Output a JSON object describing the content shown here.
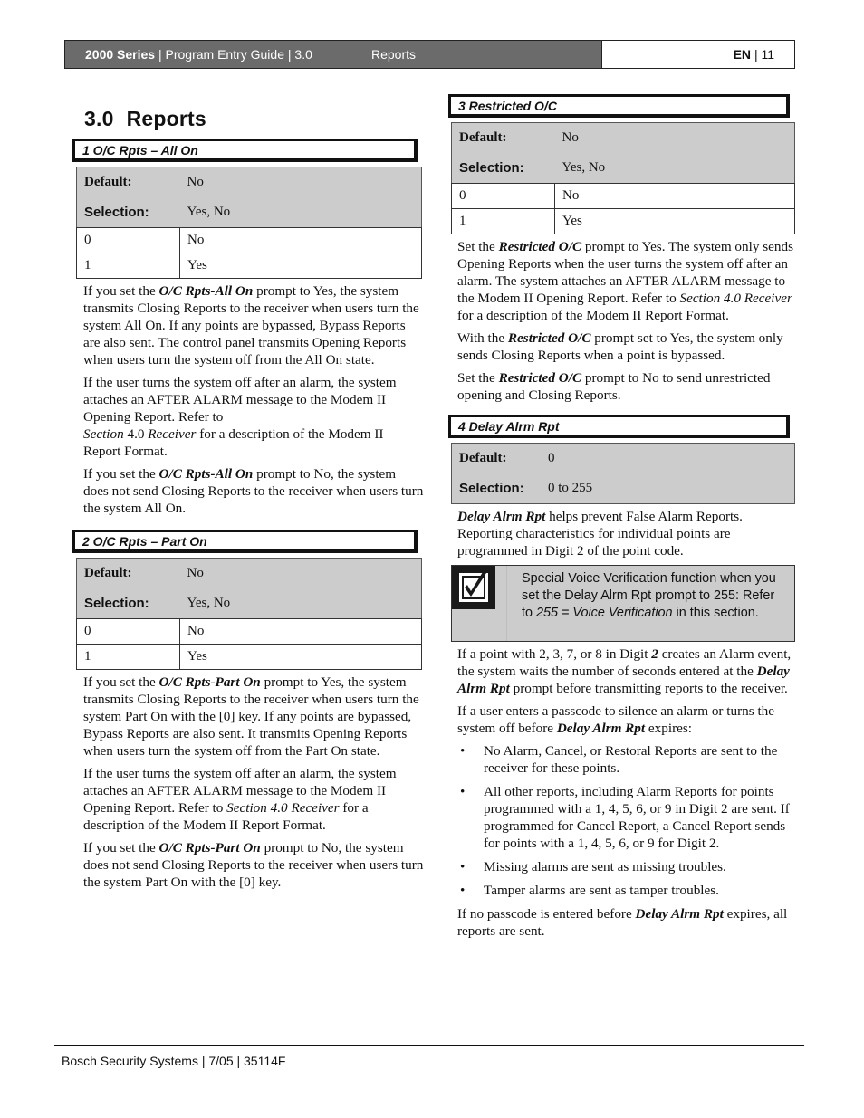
{
  "header": {
    "series": "2000 Series",
    "guide": "| Program Entry Guide | 3.0",
    "section": "Reports",
    "lang": "EN",
    "page": "| 11"
  },
  "title": {
    "number": "3.0",
    "text": "Reports"
  },
  "icons": {
    "note": "checkbox-check-icon",
    "bullet": "bullet"
  },
  "sections": [
    {
      "heading": "1 O/C Rpts – All On",
      "default_label": "Default:",
      "default_value": "No",
      "selection_label": "Selection:",
      "selection_value": "Yes, No",
      "options": [
        {
          "code": "0",
          "label": "No"
        },
        {
          "code": "1",
          "label": "Yes"
        }
      ],
      "paragraphs": [
        {
          "pre": "If you set the ",
          "em": "O/C Rpts-All On",
          "post": " prompt to Yes, the system transmits Closing Reports to the receiver when users turn the system All On. If any points are bypassed, Bypass Reports are also sent. The control panel transmits Opening Reports when users turn the system off from the All On state."
        },
        {
          "pre": "If the user turns the system off after an alarm, the system attaches an AFTER ALARM message to the Modem II Opening Report. Refer to",
          "ref1": "Section",
          "mid": " 4.0 ",
          "ref2": "Receiver",
          "post": " for a description of the Modem II Report Format."
        },
        {
          "pre": "If you set the ",
          "em": "O/C Rpts-All On",
          "post": " prompt to No, the system does not send Closing Reports to the receiver when users turn the system All On."
        }
      ]
    },
    {
      "heading": "2 O/C Rpts – Part On",
      "default_label": "Default:",
      "default_value": "No",
      "selection_label": "Selection:",
      "selection_value": "Yes, No",
      "options": [
        {
          "code": "0",
          "label": "No"
        },
        {
          "code": "1",
          "label": "Yes"
        }
      ],
      "paragraphs": [
        {
          "pre": "If you set the ",
          "em": "O/C Rpts-Part On",
          "post": " prompt to Yes, the system transmits Closing Reports to the receiver when users turn the system Part On with the [0] key. If any points are bypassed, Bypass Reports are also sent. It transmits Opening Reports when users turn the system off from the Part On state."
        },
        {
          "pre": "If the user turns the system off after an alarm, the system attaches an AFTER ALARM message to the Modem II  Opening Report. Refer to ",
          "ref": "Section 4.0 Receiver",
          "post": " for a description of the Modem II Report Format."
        },
        {
          "pre": "If you set the ",
          "em": "O/C Rpts-Part On",
          "post": " prompt to No, the system does not send Closing Reports to the receiver when users turn the system Part On with the [0] key."
        }
      ]
    },
    {
      "heading": "3 Restricted O/C",
      "default_label": "Default:",
      "default_value": "No",
      "selection_label": "Selection:",
      "selection_value": "Yes, No",
      "options": [
        {
          "code": "0",
          "label": "No"
        },
        {
          "code": "1",
          "label": "Yes"
        }
      ],
      "paragraphs": [
        {
          "pre": "Set the ",
          "em": "Restricted O/C",
          "mid": " prompt to Yes. The system only sends Opening Reports when the user turns the system off after an alarm. The system attaches an AFTER ALARM message to the Modem II Opening Report. Refer to ",
          "ref": "Section 4.0 Receiver",
          "post": " for a description of the Modem II Report Format."
        },
        {
          "pre": "With the ",
          "em": "Restricted O/C",
          "post": " prompt set to Yes, the system only sends Closing Reports when a point is bypassed."
        },
        {
          "pre": "Set the ",
          "em": "Restricted O/C",
          "post": " prompt to No to send unrestricted opening and Closing Reports."
        }
      ]
    },
    {
      "heading": "4 Delay Alrm Rpt",
      "default_label": "Default:",
      "default_value": "0",
      "selection_label": "Selection:",
      "selection_value": "0 to 255",
      "paragraphs": [
        {
          "em": "Delay Alrm Rpt",
          "post": " helps prevent False Alarm Reports. Reporting characteristics for individual points are programmed in Digit 2 of the point code."
        },
        {
          "pre": "If a point with 2, 3, 7, or 8 in Digit ",
          "em1": "2",
          "mid": " creates an Alarm event, the system waits the number of seconds entered at the ",
          "em2": "Delay Alrm Rpt",
          "post": " prompt before transmitting reports to the receiver."
        },
        {
          "pre": "If a user enters a passcode to silence an alarm or turns the system off before ",
          "em": "Delay Alrm Rpt",
          "post": " expires:"
        },
        {
          "pre": "If no passcode is entered before ",
          "em": "Delay Alrm Rpt",
          "post": " expires, all reports are sent."
        }
      ],
      "note": {
        "line1": "Special Voice Verification function when you set the Delay Alrm Rpt prompt to 255: Refer to ",
        "ref": "255 = Voice Verification",
        "line2": " in this section."
      },
      "bullets": [
        "No Alarm, Cancel, or Restoral Reports are sent to the receiver for these points.",
        "All other reports, including Alarm Reports for points programmed with a 1, 4, 5, 6, or 9 in Digit 2 are sent. If programmed for Cancel Report, a Cancel Report sends for points with a 1, 4, 5, 6, or 9 for Digit 2.",
        "Missing alarms are sent as missing troubles.",
        "Tamper alarms are sent as tamper troubles."
      ]
    }
  ],
  "footer": {
    "text": "Bosch Security Systems | 7/05 | 35114F"
  }
}
